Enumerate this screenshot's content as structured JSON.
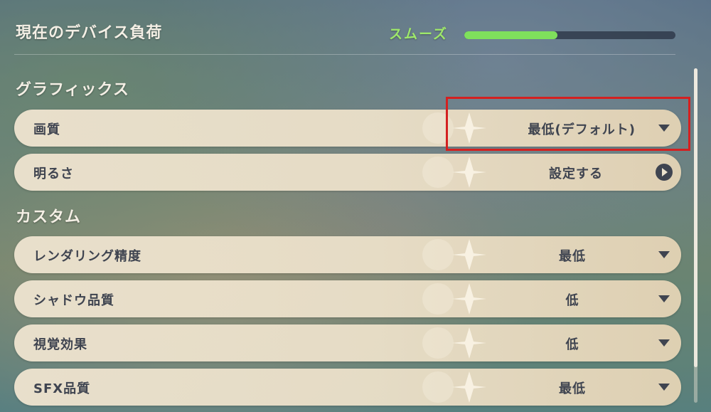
{
  "header": {
    "title": "現在のデバイス負荷",
    "status_label": "スムーズ",
    "load_fraction": 0.44
  },
  "sections": [
    {
      "title": "グラフィックス",
      "rows": [
        {
          "label": "画質",
          "value": "最低(デフォルト)",
          "control": "dropdown"
        },
        {
          "label": "明るさ",
          "value": "設定する",
          "control": "arrow"
        }
      ]
    },
    {
      "title": "カスタム",
      "rows": [
        {
          "label": "レンダリング精度",
          "value": "最低",
          "control": "dropdown"
        },
        {
          "label": "シャドウ品質",
          "value": "低",
          "control": "dropdown"
        },
        {
          "label": "視覚効果",
          "value": "低",
          "control": "dropdown"
        },
        {
          "label": "SFX品質",
          "value": "最低",
          "control": "dropdown"
        }
      ]
    }
  ],
  "colors": {
    "status_green": "#9ee86a",
    "load_fill": "#7fe05c",
    "highlight_red": "#d42020",
    "row_text": "#3f4450"
  }
}
